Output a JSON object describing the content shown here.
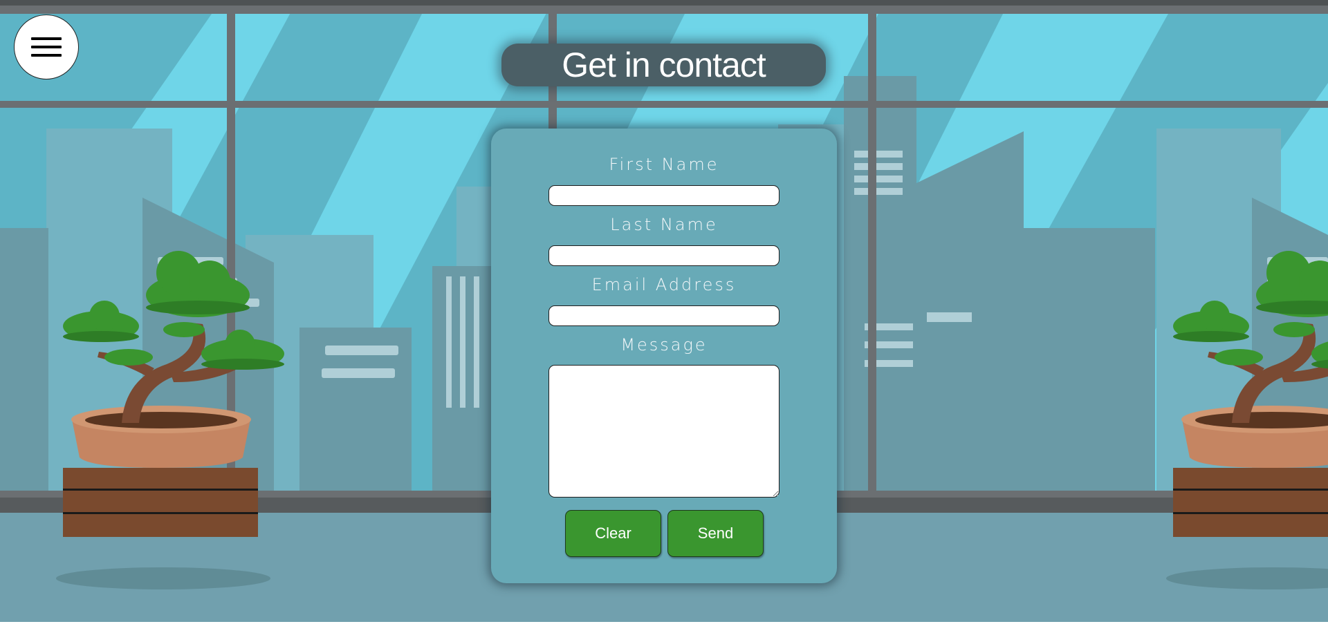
{
  "page": {
    "title": "Get in contact"
  },
  "menu": {
    "icon": "hamburger-menu-icon"
  },
  "form": {
    "first_name": {
      "label": "First Name",
      "value": "",
      "placeholder": ""
    },
    "last_name": {
      "label": "Last Name",
      "value": "",
      "placeholder": ""
    },
    "email": {
      "label": "Email Address",
      "value": "",
      "placeholder": ""
    },
    "message": {
      "label": "Message",
      "value": "",
      "placeholder": ""
    },
    "clear_label": "Clear",
    "send_label": "Send"
  },
  "colors": {
    "sky": "#6fd5e8",
    "window_frame": "#6b6f72",
    "floor": "#71a0ae",
    "card": "#68aab7",
    "title_pill": "#4b5f66",
    "button_green": "#3a962f",
    "foliage": "#3a962f",
    "pot": "#c58562",
    "crate": "#7a4a2e"
  }
}
